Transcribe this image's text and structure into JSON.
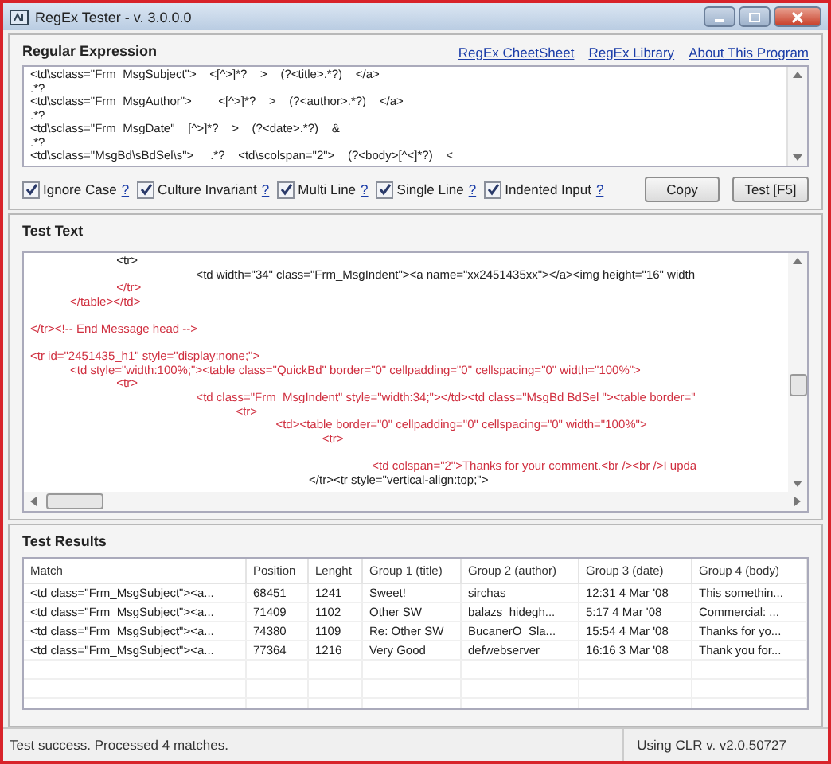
{
  "window": {
    "title": "RegEx Tester - v. 3.0.0.0"
  },
  "regex": {
    "label": "Regular Expression",
    "links": [
      "RegEx CheetSheet",
      "RegEx Library",
      "About This Program"
    ],
    "lines": [
      "<td\\sclass=\"Frm_MsgSubject\">    <[^>]*?    >    (?<title>.*?)    </a>",
      ".*?",
      "<td\\sclass=\"Frm_MsgAuthor\">        <[^>]*?    >    (?<author>.*?)    </a>",
      ".*?",
      "<td\\sclass=\"Frm_MsgDate\"    [^>]*?    >    (?<date>.*?)    &",
      ".*?",
      "<td\\sclass=\"MsgBd\\sBdSel\\s\">     .*?    <td\\scolspan=\"2\">    (?<body>[^<]*?)    <"
    ],
    "options": [
      {
        "label": "Ignore Case",
        "checked": true,
        "help": "?"
      },
      {
        "label": "Culture Invariant",
        "checked": true,
        "help": "?"
      },
      {
        "label": "Multi Line",
        "checked": true,
        "help": "?"
      },
      {
        "label": "Single Line",
        "checked": true,
        "help": "?"
      },
      {
        "label": "Indented Input",
        "checked": true,
        "help": "?"
      }
    ],
    "buttons": [
      "Copy",
      "Test [F5]"
    ]
  },
  "test_text": {
    "label": "Test Text",
    "blocks": [
      [
        {
          "text": "                          <tr>",
          "color": "#222222"
        },
        {
          "text": "                                                  <td width=\"34\" class=\"Frm_MsgIndent\"><a name=\"xx2451435xx\"></a><img height=\"16\" width",
          "color": "#222222"
        },
        {
          "text": "                          </tr>",
          "color": "#d03040"
        },
        {
          "text": "            </table></td>",
          "color": "#d03040"
        }
      ],
      [
        {
          "text": "</tr><!-- End Message head -->",
          "color": "#d03040"
        }
      ],
      [
        {
          "text": "<tr id=\"2451435_h1\" style=\"display:none;\">",
          "color": "#d03040"
        },
        {
          "text": "            <td style=\"width:100%;\"><table class=\"QuickBd\" border=\"0\" cellpadding=\"0\" cellspacing=\"0\" width=\"100%\">",
          "color": "#d03040"
        },
        {
          "text": "                          <tr>",
          "color": "#d03040"
        },
        {
          "text": "                                                  <td class=\"Frm_MsgIndent\" style=\"width:34;\"></td><td class=\"MsgBd BdSel \"><table border=\"",
          "color": "#d03040"
        },
        {
          "text": "                                                              <tr>",
          "color": "#d03040"
        },
        {
          "text": "                                                                          <td><table border=\"0\" cellpadding=\"0\" cellspacing=\"0\" width=\"100%\">",
          "color": "#d03040"
        },
        {
          "text": "                                                                                        <tr>",
          "color": "#d03040"
        }
      ],
      [
        {
          "text": "                                                                                                       <td colspan=\"2\">Thanks for your comment.<br /><br />I upda",
          "color": "#d03040"
        },
        {
          "text": "                                                                                    </tr><tr style=\"vertical-align:top;\">",
          "color": "#222222"
        }
      ]
    ]
  },
  "results": {
    "label": "Test Results",
    "columns": [
      "Match",
      "Position",
      "Lenght",
      "Group 1 (title)",
      "Group 2 (author)",
      "Group 3 (date)",
      "Group 4 (body)"
    ],
    "rows": [
      [
        "<td class=\"Frm_MsgSubject\"><a...",
        "68451",
        "1241",
        "Sweet!",
        "sirchas",
        "12:31 4 Mar '08",
        "This somethin..."
      ],
      [
        "<td class=\"Frm_MsgSubject\"><a...",
        "71409",
        "1102",
        "Other SW",
        "balazs_hidegh...",
        "5:17 4 Mar '08",
        "Commercial: ..."
      ],
      [
        "<td class=\"Frm_MsgSubject\"><a...",
        "74380",
        "1109",
        "Re: Other SW",
        "BucanerO_Sla...",
        "15:54 4 Mar '08",
        "Thanks for yo..."
      ],
      [
        "<td class=\"Frm_MsgSubject\"><a...",
        "77364",
        "1216",
        "Very Good",
        "defwebserver",
        "16:16 3 Mar '08",
        "Thank you for..."
      ]
    ]
  },
  "status_bar": [
    "Test success. Processed 4 matches.",
    "Using CLR v. v2.0.50727"
  ]
}
